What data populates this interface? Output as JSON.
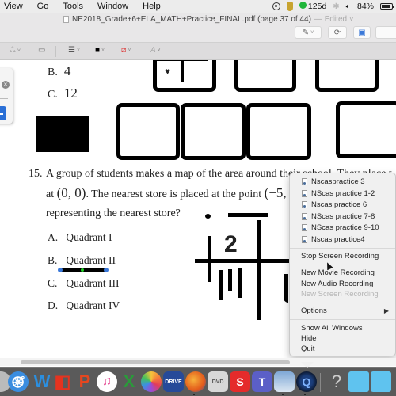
{
  "menubar": {
    "items": [
      "View",
      "Go",
      "Tools",
      "Window",
      "Help"
    ],
    "status": {
      "time_remaining": "125d",
      "battery": "84%"
    }
  },
  "window": {
    "title": "NE2018_Grade+6+ELA_MATH+Practice_FINAL.pdf (page 37 of 44)",
    "edited_label": "— Edited ˅"
  },
  "document": {
    "prev_answers": [
      {
        "letter": "B.",
        "value": "4"
      },
      {
        "letter": "C.",
        "value": "12"
      }
    ],
    "question": {
      "number": "15.",
      "line1": "A group of students makes a map of the area around their school. They place t",
      "line2_a": "at ",
      "line2_point1": "(0, 0)",
      "line2_b": ". The nearest store is placed at the point ",
      "line2_point2": "(−5,",
      "line3": "representing the nearest store?"
    },
    "options": [
      {
        "letter": "A.",
        "text": "Quadrant I"
      },
      {
        "letter": "B.",
        "text": "Quadrant II"
      },
      {
        "letter": "C.",
        "text": "Quadrant III"
      },
      {
        "letter": "D.",
        "text": "Quadrant IV"
      }
    ]
  },
  "context_menu": {
    "recent_files": [
      "Nscaspractice 3",
      "NScas practice 1-2",
      "Nscas practice 6",
      "NScas practice 7-8",
      "NScas practice 9-10",
      "Nscas practice4"
    ],
    "stop_recording": "Stop Screen Recording",
    "new_movie": "New Movie Recording",
    "new_audio": "New Audio Recording",
    "new_screen": "New Screen Recording",
    "options": "Options",
    "show_all": "Show All Windows",
    "hide": "Hide",
    "quit": "Quit"
  },
  "dock": {
    "apps": [
      "Finder",
      "Safari",
      "Word",
      "Office",
      "PowerPoint",
      "iTunes",
      "Excel",
      "Photos",
      "Google Drive",
      "Firefox",
      "DVD Player",
      "SketchUp",
      "Teams",
      "Preview",
      "QuickTime Player",
      "Help",
      "Documents",
      "Applications"
    ]
  }
}
